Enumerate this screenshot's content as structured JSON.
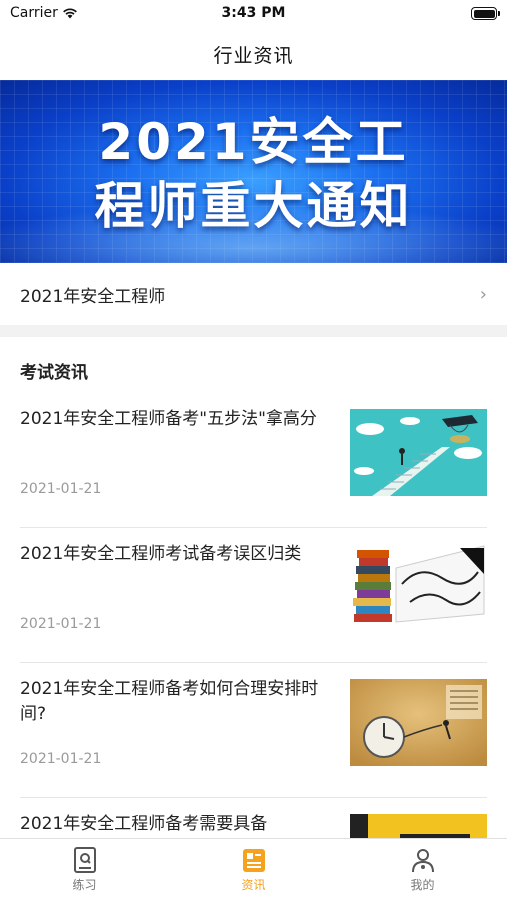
{
  "status_bar": {
    "carrier": "Carrier",
    "time": "3:43 PM"
  },
  "nav": {
    "title": "行业资讯"
  },
  "banner": {
    "line1": "2021安全工",
    "line2": "程师重大通知"
  },
  "featured_link": {
    "label": "2021年安全工程师",
    "chevron": "›"
  },
  "section": {
    "title": "考试资讯"
  },
  "news": [
    {
      "title": "2021年安全工程师备考\"五步法\"拿高分",
      "date": "2021-01-21"
    },
    {
      "title": "2021年安全工程师考试备考误区归类",
      "date": "2021-01-21"
    },
    {
      "title": "2021年安全工程师备考如何合理安排时间?",
      "date": "2021-01-21"
    },
    {
      "title": "2021年安全工程师备考需要具备",
      "date": ""
    }
  ],
  "tabs": [
    {
      "label": "练习",
      "icon": "practice-book-icon",
      "active": false
    },
    {
      "label": "资讯",
      "icon": "news-icon",
      "active": true
    },
    {
      "label": "我的",
      "icon": "profile-icon",
      "active": false
    }
  ],
  "colors": {
    "accent": "#f5a21f",
    "banner_blue": "#1b6ff0",
    "inactive": "#777777"
  }
}
